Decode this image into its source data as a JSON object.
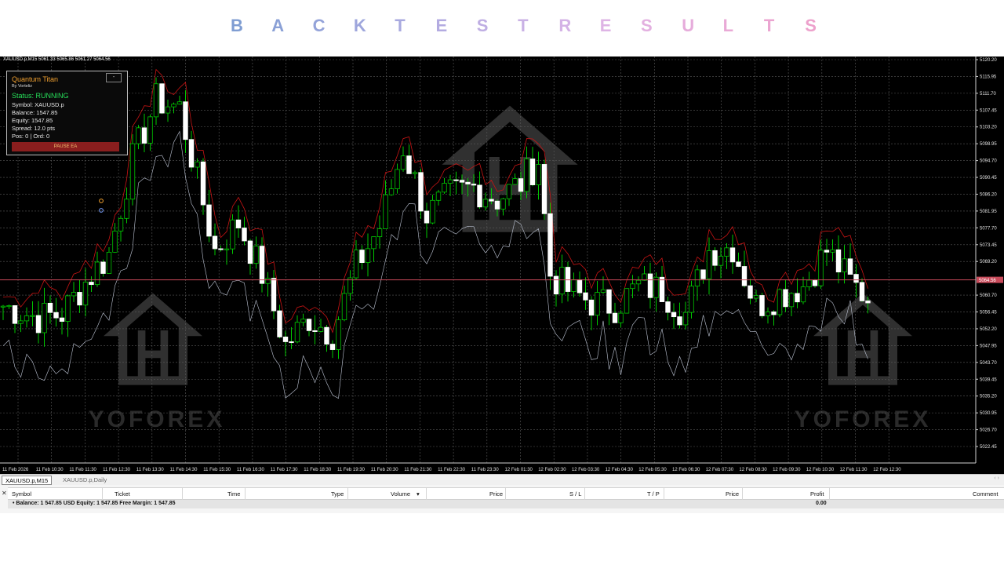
{
  "banner": {
    "letters": [
      "B",
      "A",
      "C",
      "K",
      "T",
      "E",
      "S",
      "T",
      "R",
      "E",
      "S",
      "U",
      "L",
      "T",
      "S"
    ],
    "colors": [
      "#7f9dd2",
      "#8aa0d6",
      "#94a3d9",
      "#9ea6dc",
      "#a8a9df",
      "#b3abe1",
      "#bfaee3",
      "#c9b1e5",
      "#d4b3e6",
      "#deb4e5",
      "#e3b0e0",
      "#e6acdb",
      "#e9a9d6",
      "#eba5d1",
      "#eda1cc"
    ]
  },
  "chart": {
    "symbol_info": "XAUUSD.p,M15  5061.33 5065.86 5061.27 5064.56",
    "current_price": "5064.56",
    "price_axis": [
      "5120.20",
      "5115.95",
      "5111.70",
      "5107.45",
      "5103.20",
      "5098.95",
      "5094.70",
      "5090.45",
      "5086.20",
      "5081.95",
      "5077.70",
      "5073.45",
      "5069.20",
      "5060.70",
      "5056.45",
      "5052.20",
      "5047.95",
      "5043.70",
      "5039.45",
      "5035.20",
      "5030.95",
      "5026.70",
      "5022.45"
    ],
    "time_axis": [
      "11 Feb 2026",
      "11 Feb 10:30",
      "11 Feb 11:30",
      "11 Feb 12:30",
      "11 Feb 13:30",
      "11 Feb 14:30",
      "11 Feb 15:30",
      "11 Feb 16:30",
      "11 Feb 17:30",
      "11 Feb 18:30",
      "11 Feb 19:30",
      "11 Feb 20:30",
      "11 Feb 21:30",
      "11 Feb 22:30",
      "11 Feb 23:30",
      "12 Feb 01:30",
      "12 Feb 02:30",
      "12 Feb 03:30",
      "12 Feb 04:30",
      "12 Feb 05:30",
      "12 Feb 06:30",
      "12 Feb 07:30",
      "12 Feb 08:30",
      "12 Feb 09:30",
      "12 Feb 10:30",
      "12 Feb 11:30",
      "12 Feb 12:30"
    ],
    "watermark_text": "YOFOREX",
    "colors": {
      "background": "#000000",
      "grid": "#5a5a5a",
      "bull": "#000000",
      "bull_border": "#00c800",
      "bear": "#ffffff",
      "wick": "#00c800",
      "upper_band": "#c81414",
      "lower_band": "#bfc6d6",
      "bid_line": "#c84a5a"
    }
  },
  "ea_panel": {
    "title": "Quantum Titan",
    "author": "By Vorteliz",
    "minimize": "-",
    "status": "Status: RUNNING",
    "symbol": "Symbol: XAUUSD.p",
    "balance": "Balance: 1547.85",
    "equity": "Equity: 1547.85",
    "spread": "Spread: 12.0 pts",
    "positions": "Pos: 0 | Ord: 0",
    "pause_button": "PAUSE EA"
  },
  "chart_tabs": {
    "active": "XAUUSD.p,M15",
    "inactive": "XAUUSD.p,Daily",
    "arrows": "‹  ›"
  },
  "terminal": {
    "close": "✕",
    "columns": [
      "Symbol",
      "Ticket",
      "Time",
      "Type",
      "Volume",
      "Price",
      "S / L",
      "T / P",
      "Price",
      "Profit",
      "Comment"
    ],
    "balance_line": "•  Balance: 1 547.85 USD  Equity: 1 547.85  Free Margin: 1 547.85",
    "profit": "0.00"
  }
}
